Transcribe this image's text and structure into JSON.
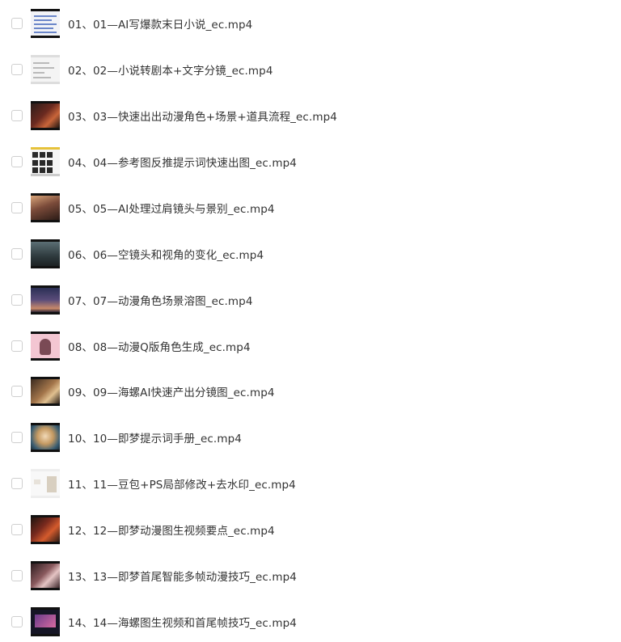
{
  "files": [
    {
      "name": "01、01—AI写爆款末日小说_ec.mp4",
      "thumb_icon": "document-thumbnail"
    },
    {
      "name": "02、02—小说转剧本+文字分镜_ec.mp4",
      "thumb_icon": "document-thumbnail"
    },
    {
      "name": "03、03—快速出出动漫角色+场景+道具流程_ec.mp4",
      "thumb_icon": "video-thumbnail"
    },
    {
      "name": "04、04—参考图反推提示词快速出图_ec.mp4",
      "thumb_icon": "image-grid-thumbnail"
    },
    {
      "name": "05、05—AI处理过肩镜头与景别_ec.mp4",
      "thumb_icon": "video-thumbnail"
    },
    {
      "name": "06、06—空镜头和视角的变化_ec.mp4",
      "thumb_icon": "video-thumbnail"
    },
    {
      "name": "07、07—动漫角色场景溶图_ec.mp4",
      "thumb_icon": "video-thumbnail"
    },
    {
      "name": "08、08—动漫Q版角色生成_ec.mp4",
      "thumb_icon": "video-thumbnail"
    },
    {
      "name": "09、09—海螺AI快速产出分镜图_ec.mp4",
      "thumb_icon": "video-thumbnail"
    },
    {
      "name": "10、10—即梦提示词手册_ec.mp4",
      "thumb_icon": "video-thumbnail"
    },
    {
      "name": "11、11—豆包+PS局部修改+去水印_ec.mp4",
      "thumb_icon": "video-thumbnail"
    },
    {
      "name": "12、12—即梦动漫图生视频要点_ec.mp4",
      "thumb_icon": "video-thumbnail"
    },
    {
      "name": "13、13—即梦首尾智能多帧动漫技巧_ec.mp4",
      "thumb_icon": "video-thumbnail"
    },
    {
      "name": "14、14—海螺图生视频和首尾帧技巧_ec.mp4",
      "thumb_icon": "video-thumbnail"
    }
  ]
}
